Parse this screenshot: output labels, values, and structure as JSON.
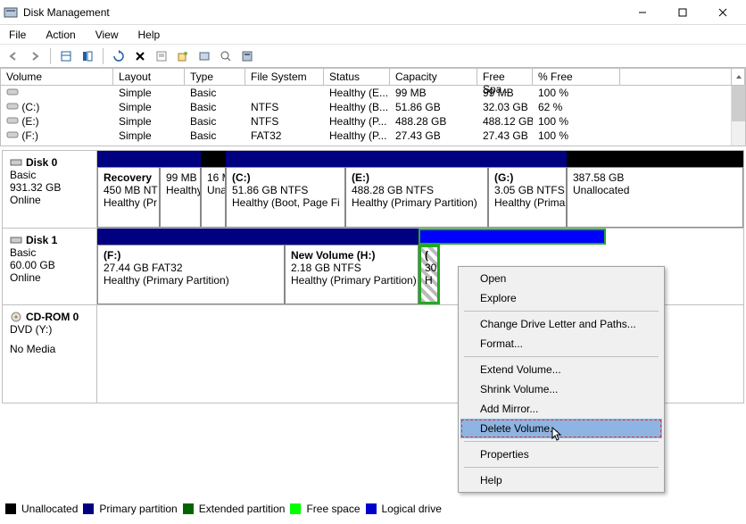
{
  "window": {
    "title": "Disk Management"
  },
  "menu": {
    "file": "File",
    "action": "Action",
    "view": "View",
    "help": "Help"
  },
  "columns": {
    "volume": "Volume",
    "layout": "Layout",
    "type": "Type",
    "fs": "File System",
    "status": "Status",
    "capacity": "Capacity",
    "free": "Free Spa...",
    "pct": "% Free"
  },
  "volumes": [
    {
      "name": "",
      "layout": "Simple",
      "type": "Basic",
      "fs": "",
      "status": "Healthy (E...",
      "capacity": "99 MB",
      "free": "99 MB",
      "pct": "100 %"
    },
    {
      "name": "(C:)",
      "layout": "Simple",
      "type": "Basic",
      "fs": "NTFS",
      "status": "Healthy (B...",
      "capacity": "51.86 GB",
      "free": "32.03 GB",
      "pct": "62 %"
    },
    {
      "name": "(E:)",
      "layout": "Simple",
      "type": "Basic",
      "fs": "NTFS",
      "status": "Healthy (P...",
      "capacity": "488.28 GB",
      "free": "488.12 GB",
      "pct": "100 %"
    },
    {
      "name": "(F:)",
      "layout": "Simple",
      "type": "Basic",
      "fs": "FAT32",
      "status": "Healthy (P...",
      "capacity": "27.43 GB",
      "free": "27.43 GB",
      "pct": "100 %"
    }
  ],
  "disks": {
    "d0": {
      "name": "Disk 0",
      "type": "Basic",
      "size": "931.32 GB",
      "state": "Online",
      "parts": [
        {
          "title": "Recovery",
          "line2": "450 MB NT",
          "line3": "Healthy (Pr"
        },
        {
          "title": "",
          "line2": "99 MB",
          "line3": "Healthy"
        },
        {
          "title": "",
          "line2": "16 M",
          "line3": "Una"
        },
        {
          "title": "(C:)",
          "line2": "51.86 GB NTFS",
          "line3": "Healthy (Boot, Page Fi"
        },
        {
          "title": "(E:)",
          "line2": "488.28 GB NTFS",
          "line3": "Healthy (Primary Partition)"
        },
        {
          "title": "(G:)",
          "line2": "3.05 GB NTFS",
          "line3": "Healthy (Primar"
        },
        {
          "title": "",
          "line2": "387.58 GB",
          "line3": "Unallocated"
        }
      ]
    },
    "d1": {
      "name": "Disk 1",
      "type": "Basic",
      "size": "60.00 GB",
      "state": "Online",
      "parts": [
        {
          "title": "(F:)",
          "line2": "27.44 GB FAT32",
          "line3": "Healthy (Primary Partition)"
        },
        {
          "title": "New Volume  (H:)",
          "line2": "2.18 GB NTFS",
          "line3": "Healthy (Primary Partition)"
        },
        {
          "title": "(",
          "line2": "30",
          "line3": "H"
        }
      ]
    },
    "cd": {
      "name": "CD-ROM 0",
      "line2": "DVD (Y:)",
      "line3": "No Media"
    }
  },
  "legend": {
    "unalloc": "Unallocated",
    "primary": "Primary partition",
    "extended": "Extended partition",
    "free": "Free space",
    "logical": "Logical drive"
  },
  "context": {
    "open": "Open",
    "explore": "Explore",
    "change": "Change Drive Letter and Paths...",
    "format": "Format...",
    "extend": "Extend Volume...",
    "shrink": "Shrink Volume...",
    "mirror": "Add Mirror...",
    "delete": "Delete Volume...",
    "props": "Properties",
    "help": "Help"
  }
}
